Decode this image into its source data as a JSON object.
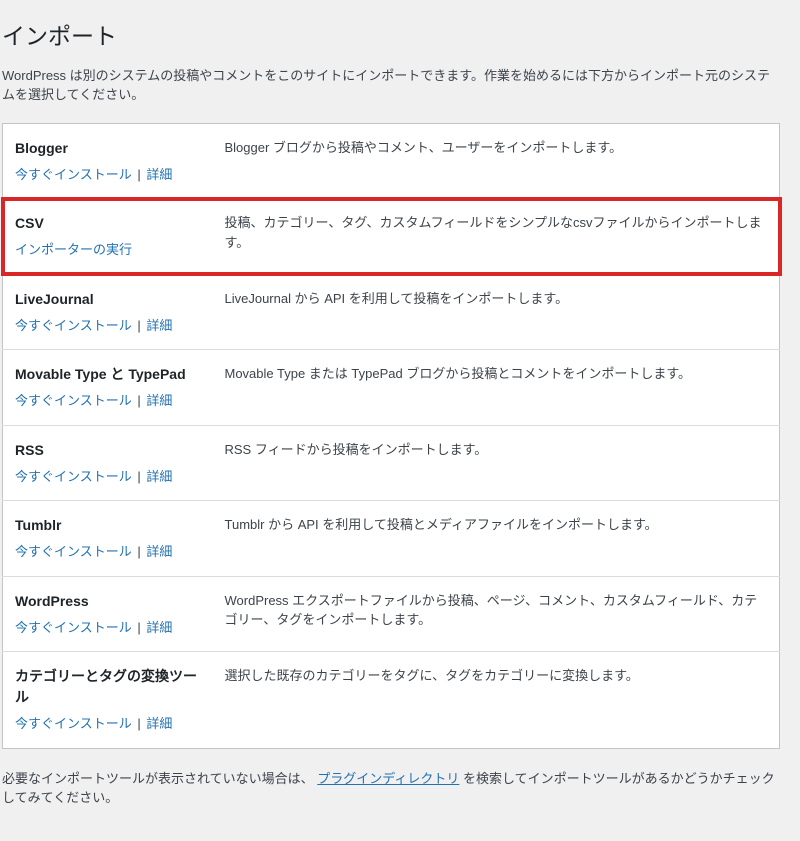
{
  "page": {
    "title": "インポート",
    "intro": "WordPress は別のシステムの投稿やコメントをこのサイトにインポートできます。作業を始めるには下方からインポート元のシステムを選択してください。",
    "footer_prefix": "必要なインポートツールが表示されていない場合は、",
    "footer_link": "プラグインディレクトリ",
    "footer_suffix": "を検索してインポートツールがあるかどうかチェックしてみてください。"
  },
  "actions": {
    "install_now": "今すぐインストール",
    "details": "詳細",
    "run_importer": "インポーターの実行"
  },
  "importers": [
    {
      "name": "Blogger",
      "desc": "Blogger ブログから投稿やコメント、ユーザーをインポートします。",
      "mode": "install"
    },
    {
      "name": "CSV",
      "desc": "投稿、カテゴリー、タグ、カスタムフィールドをシンプルなcsvファイルからインポートします。",
      "mode": "run",
      "highlight": true
    },
    {
      "name": "LiveJournal",
      "desc": "LiveJournal から API を利用して投稿をインポートします。",
      "mode": "install"
    },
    {
      "name": "Movable Type と TypePad",
      "desc": "Movable Type または TypePad ブログから投稿とコメントをインポートします。",
      "mode": "install"
    },
    {
      "name": "RSS",
      "desc": "RSS フィードから投稿をインポートします。",
      "mode": "install"
    },
    {
      "name": "Tumblr",
      "desc": "Tumblr から API を利用して投稿とメディアファイルをインポートします。",
      "mode": "install"
    },
    {
      "name": "WordPress",
      "desc": "WordPress エクスポートファイルから投稿、ページ、コメント、カスタムフィールド、カテゴリー、タグをインポートします。",
      "mode": "install"
    },
    {
      "name": "カテゴリーとタグの変換ツール",
      "desc": "選択した既存のカテゴリーをタグに、タグをカテゴリーに変換します。",
      "mode": "install"
    }
  ]
}
